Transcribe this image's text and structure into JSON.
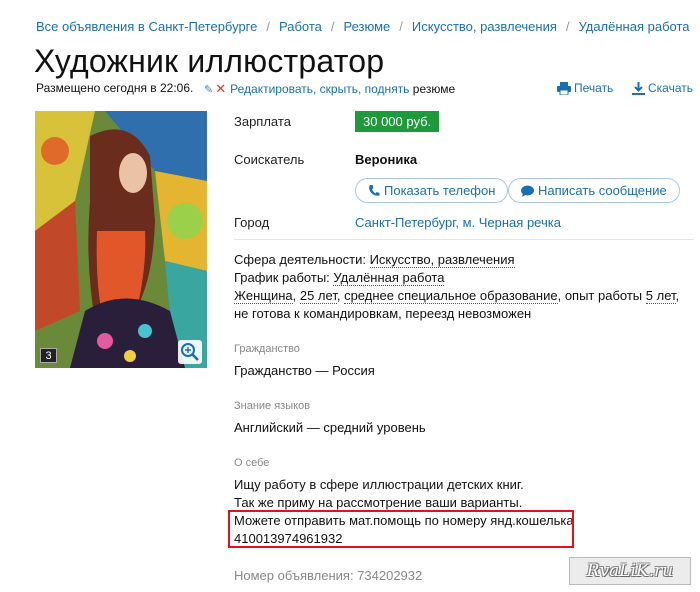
{
  "breadcrumbs": [
    "Все объявления в Санкт-Петербурге",
    "Работа",
    "Резюме",
    "Искусство, развлечения",
    "Удалённая работа"
  ],
  "title": "Художник иллюстратор",
  "meta": {
    "posted": "Размещено сегодня в 22:06."
  },
  "edit": {
    "links": "Редактировать, скрыть, поднять",
    "suffix": "резюме"
  },
  "actions": {
    "print": "Печать",
    "download": "Скачать"
  },
  "photo": {
    "count": "3"
  },
  "salary": {
    "label": "Зарплата",
    "value": "30 000 руб."
  },
  "applicant": {
    "label": "Соискатель",
    "name": "Вероника"
  },
  "buttons": {
    "phone": "Показать телефон",
    "message": "Написать сообщение"
  },
  "city": {
    "label": "Город",
    "value": "Санкт-Петербург, м. Черная речка"
  },
  "details": {
    "sphere_label": "Сфера деятельности:",
    "sphere_value": "Искусство, развлечения",
    "schedule_label": "График работы:",
    "schedule_value": "Удалённая работа",
    "gender": "Женщина",
    "age": "25 лет",
    "education": "среднее специальное образование",
    "experience_prefix": ", опыт работы ",
    "experience_value": "5 лет",
    "rest": ", не готова к командировкам, переезд невозможен"
  },
  "citizenship": {
    "heading": "Гражданство",
    "value": "Гражданство — Россия"
  },
  "languages": {
    "heading": "Знание языков",
    "value": "Английский — средний уровень"
  },
  "about": {
    "heading": "О себе",
    "lines": [
      "Ищу работу в сфере иллюстрации детских книг.",
      "Так же приму на рассмотрение ваши варианты.",
      "Можете отправить мат.помощь по номеру янд.кошелька",
      "410013974961932"
    ]
  },
  "ad_number": "Номер объявления: 734202932",
  "watermark": "RvaLiK.ru",
  "colors": {
    "link": "#1a6fb0",
    "salary_bg": "#1e9a3c",
    "highlight": "#e3121a"
  }
}
